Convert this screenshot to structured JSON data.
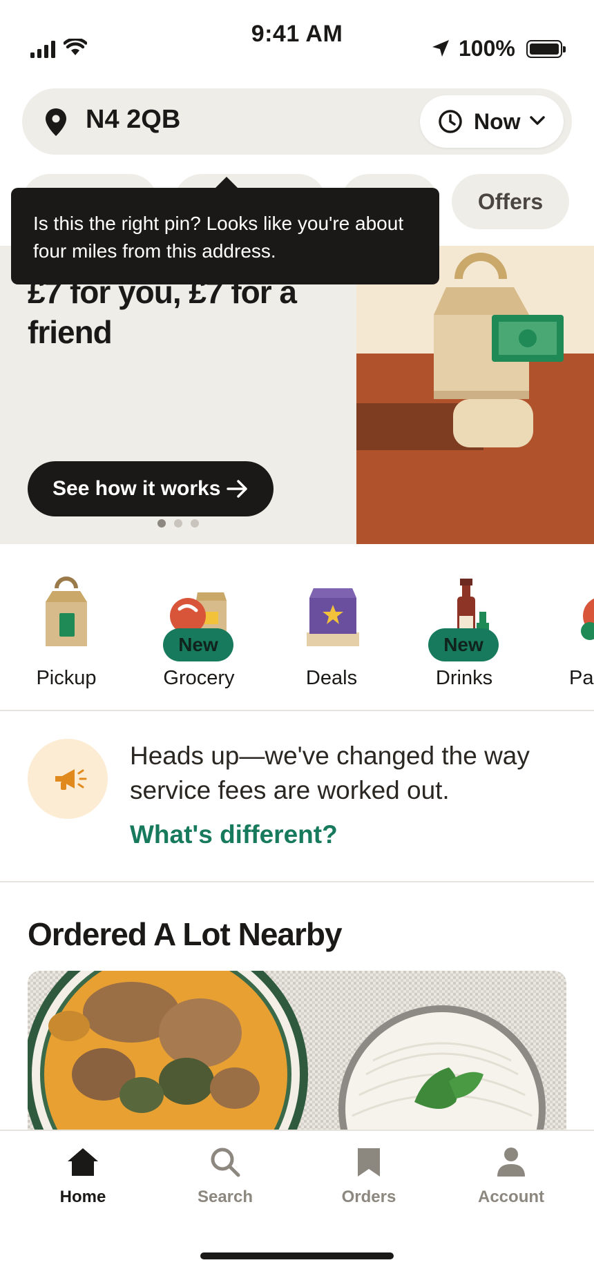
{
  "status_bar": {
    "time": "9:41 AM",
    "battery": "100%"
  },
  "location_bar": {
    "address": "N4 2QB",
    "time_selector": "Now"
  },
  "filter_chips": [
    "",
    "",
    "",
    "Offers"
  ],
  "tooltip": {
    "text": "Is this the right pin? Looks like you're about four miles from this address."
  },
  "promo": {
    "title": "£7 for you, £7 for a friend",
    "cta": "See how it works",
    "slide_count": 3,
    "active_slide": 1
  },
  "categories": [
    {
      "label": "Pickup",
      "badge": ""
    },
    {
      "label": "Grocery",
      "badge": "New"
    },
    {
      "label": "Deals",
      "badge": ""
    },
    {
      "label": "Drinks",
      "badge": "New"
    },
    {
      "label": "Pa",
      "badge": ""
    }
  ],
  "notice": {
    "text": "Heads up—we've changed the way service fees are worked out.",
    "link": "What's different?"
  },
  "section": {
    "title": "Ordered A Lot Nearby"
  },
  "tab_bar": {
    "tabs": [
      {
        "label": "Home",
        "icon": "home-icon",
        "active": true
      },
      {
        "label": "Search",
        "icon": "search-icon",
        "active": false
      },
      {
        "label": "Orders",
        "icon": "bookmark-icon",
        "active": false
      },
      {
        "label": "Account",
        "icon": "person-icon",
        "active": false
      }
    ]
  },
  "colors": {
    "accent_green": "#177a5c",
    "dark": "#1b1917",
    "surface": "#efede8",
    "promo_orange": "#b0532c"
  }
}
